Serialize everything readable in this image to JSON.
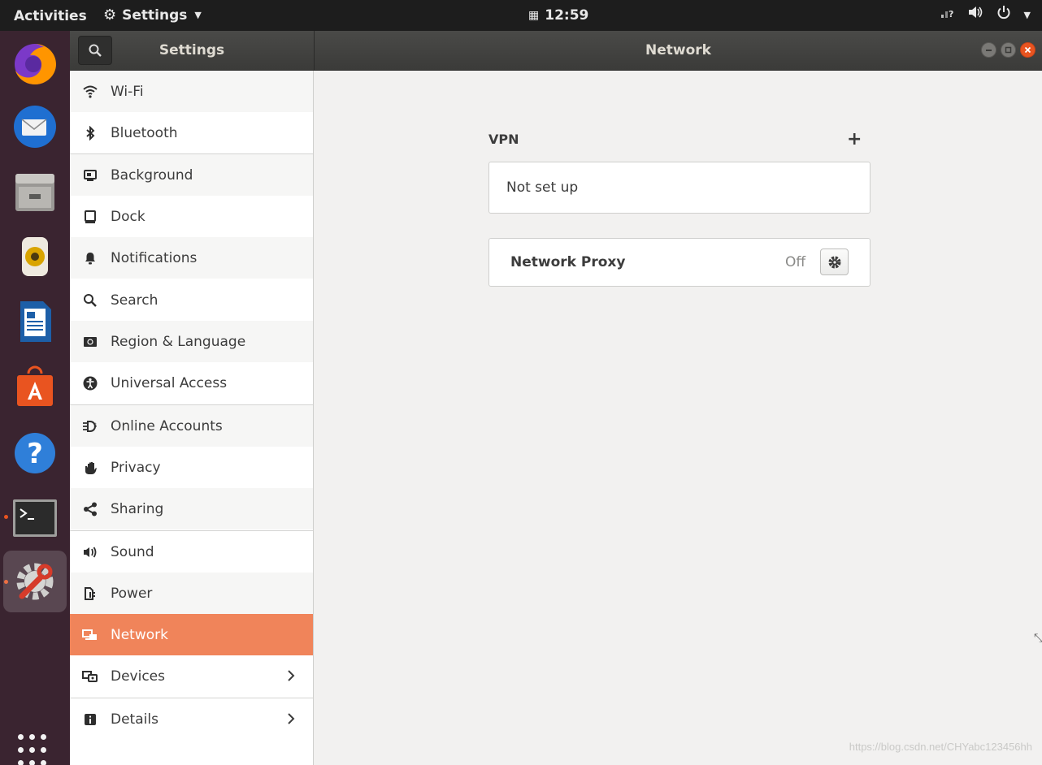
{
  "topbar": {
    "activities": "Activities",
    "app_menu_label": "Settings",
    "clock": "12:59"
  },
  "dock": {
    "apps": [
      "firefox-icon",
      "thunderbird-icon",
      "files-icon",
      "rhythmbox-icon",
      "writer-icon",
      "software-icon",
      "help-icon",
      "terminal-icon",
      "settings-icon"
    ]
  },
  "headerbar": {
    "sidebar_title": "Settings",
    "panel_title": "Network"
  },
  "sidebar": {
    "items": [
      {
        "label": "Wi-Fi",
        "icon": "wifi-icon"
      },
      {
        "label": "Bluetooth",
        "icon": "bluetooth-icon"
      },
      {
        "label": "Background",
        "icon": "background-icon"
      },
      {
        "label": "Dock",
        "icon": "dock-icon"
      },
      {
        "label": "Notifications",
        "icon": "bell-icon"
      },
      {
        "label": "Search",
        "icon": "search-icon"
      },
      {
        "label": "Region & Language",
        "icon": "region-icon"
      },
      {
        "label": "Universal Access",
        "icon": "accessibility-icon"
      },
      {
        "label": "Online Accounts",
        "icon": "online-accounts-icon"
      },
      {
        "label": "Privacy",
        "icon": "hand-icon"
      },
      {
        "label": "Sharing",
        "icon": "share-icon"
      },
      {
        "label": "Sound",
        "icon": "speaker-icon"
      },
      {
        "label": "Power",
        "icon": "power-plug-icon"
      },
      {
        "label": "Network",
        "icon": "network-icon"
      },
      {
        "label": "Devices",
        "icon": "devices-icon"
      },
      {
        "label": "Details",
        "icon": "info-icon"
      }
    ],
    "selected": "Network"
  },
  "main": {
    "vpn": {
      "header": "VPN",
      "add_label": "+",
      "status": "Not set up"
    },
    "proxy": {
      "label": "Network Proxy",
      "state": "Off"
    }
  },
  "watermark": "https://blog.csdn.net/CHYabc123456hh",
  "colors": {
    "accent": "#f0845a",
    "topbar": "#1d1d1d",
    "dock": "#3a2430",
    "close_button": "#e95420"
  }
}
